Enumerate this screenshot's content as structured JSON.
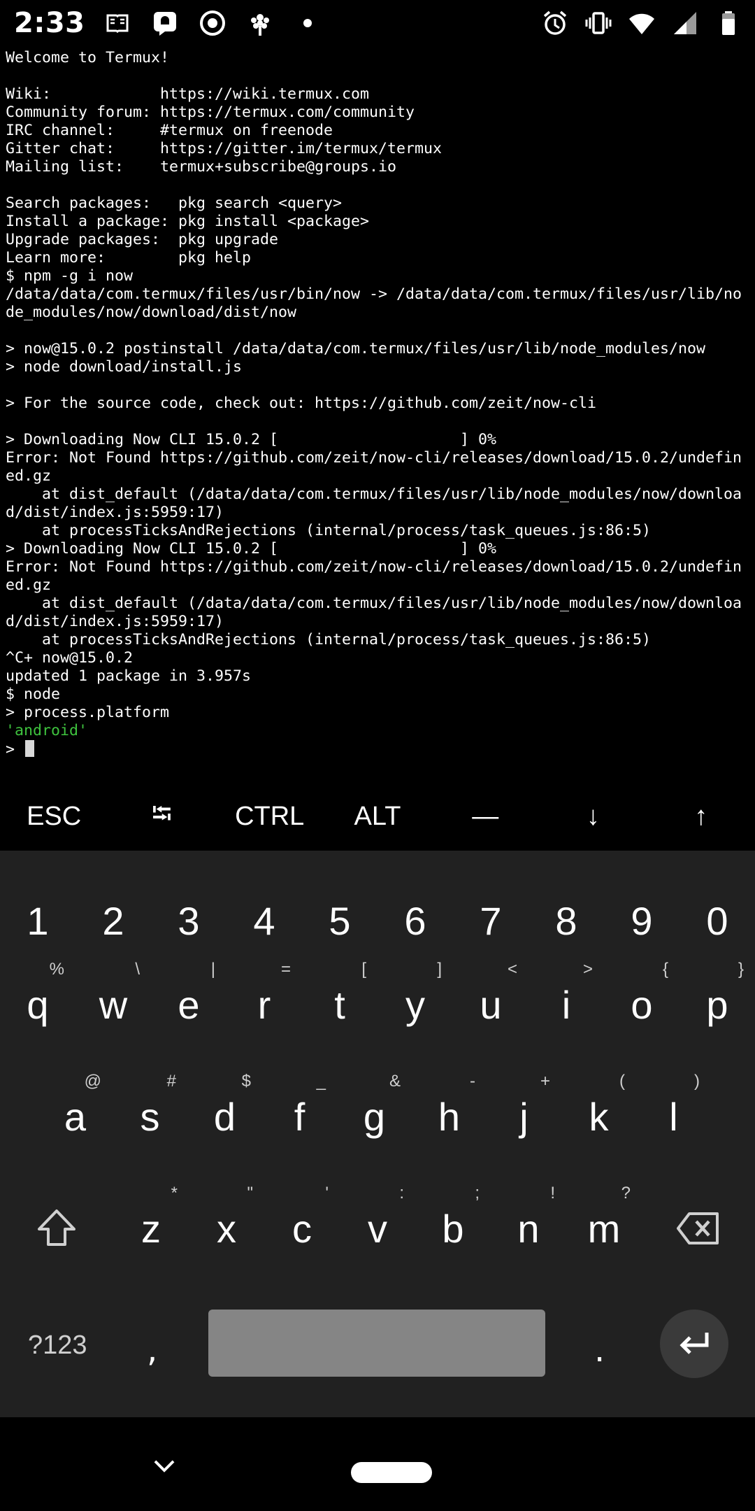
{
  "status_bar": {
    "time": "2:33",
    "left_icons": [
      "reader-icon",
      "message-icon",
      "target-icon",
      "tree-icon",
      "dot-icon"
    ],
    "right_icons": [
      "alarm-icon",
      "vibrate-icon",
      "wifi-icon",
      "signal-icon",
      "battery-icon"
    ]
  },
  "terminal": {
    "lines": [
      "Welcome to Termux!",
      "",
      "Wiki:            https://wiki.termux.com",
      "Community forum: https://termux.com/community",
      "IRC channel:     #termux on freenode",
      "Gitter chat:     https://gitter.im/termux/termux",
      "Mailing list:    termux+subscribe@groups.io",
      "",
      "Search packages:   pkg search <query>",
      "Install a package: pkg install <package>",
      "Upgrade packages:  pkg upgrade",
      "Learn more:        pkg help",
      "$ npm -g i now",
      "/data/data/com.termux/files/usr/bin/now -> /data/data/com.termux/files/usr/lib/no",
      "de_modules/now/download/dist/now",
      "",
      "> now@15.0.2 postinstall /data/data/com.termux/files/usr/lib/node_modules/now",
      "> node download/install.js",
      "",
      "> For the source code, check out: https://github.com/zeit/now-cli",
      "",
      "> Downloading Now CLI 15.0.2 [                    ] 0%",
      "Error: Not Found https://github.com/zeit/now-cli/releases/download/15.0.2/undefin",
      "ed.gz",
      "    at dist_default (/data/data/com.termux/files/usr/lib/node_modules/now/downloa",
      "d/dist/index.js:5959:17)",
      "    at processTicksAndRejections (internal/process/task_queues.js:86:5)",
      "> Downloading Now CLI 15.0.2 [                    ] 0%",
      "Error: Not Found https://github.com/zeit/now-cli/releases/download/15.0.2/undefin",
      "ed.gz",
      "    at dist_default (/data/data/com.termux/files/usr/lib/node_modules/now/downloa",
      "d/dist/index.js:5959:17)",
      "    at processTicksAndRejections (internal/process/task_queues.js:86:5)",
      "^C+ now@15.0.2",
      "updated 1 package in 3.957s",
      "$ node",
      "> process.platform"
    ],
    "result_line": "'android'",
    "result_color": "#3ec23e",
    "prompt": "> "
  },
  "extra_keys": [
    "ESC",
    "⭾",
    "CTRL",
    "ALT",
    "—",
    "↓",
    "↑"
  ],
  "keyboard": {
    "numbers": [
      "1",
      "2",
      "3",
      "4",
      "5",
      "6",
      "7",
      "8",
      "9",
      "0"
    ],
    "row_q": [
      {
        "key": "q",
        "hint": "%"
      },
      {
        "key": "w",
        "hint": "\\"
      },
      {
        "key": "e",
        "hint": "|"
      },
      {
        "key": "r",
        "hint": "="
      },
      {
        "key": "t",
        "hint": "["
      },
      {
        "key": "y",
        "hint": "]"
      },
      {
        "key": "u",
        "hint": "<"
      },
      {
        "key": "i",
        "hint": ">"
      },
      {
        "key": "o",
        "hint": "{"
      },
      {
        "key": "p",
        "hint": "}"
      }
    ],
    "row_a": [
      {
        "key": "a",
        "hint": "@"
      },
      {
        "key": "s",
        "hint": "#"
      },
      {
        "key": "d",
        "hint": "$"
      },
      {
        "key": "f",
        "hint": "_"
      },
      {
        "key": "g",
        "hint": "&"
      },
      {
        "key": "h",
        "hint": "-"
      },
      {
        "key": "j",
        "hint": "+"
      },
      {
        "key": "k",
        "hint": "("
      },
      {
        "key": "l",
        "hint": ")"
      }
    ],
    "row_z": [
      {
        "key": "z",
        "hint": "*"
      },
      {
        "key": "x",
        "hint": "\""
      },
      {
        "key": "c",
        "hint": "'"
      },
      {
        "key": "v",
        "hint": ":"
      },
      {
        "key": "b",
        "hint": ";"
      },
      {
        "key": "n",
        "hint": "!"
      },
      {
        "key": "m",
        "hint": "?"
      }
    ],
    "symbols_label": "?123",
    "comma": ",",
    "period": "."
  },
  "colors": {
    "background": "#000000",
    "keyboard_bg": "#212121",
    "space_bar": "#858585",
    "cursor": "#d8d8d8"
  }
}
